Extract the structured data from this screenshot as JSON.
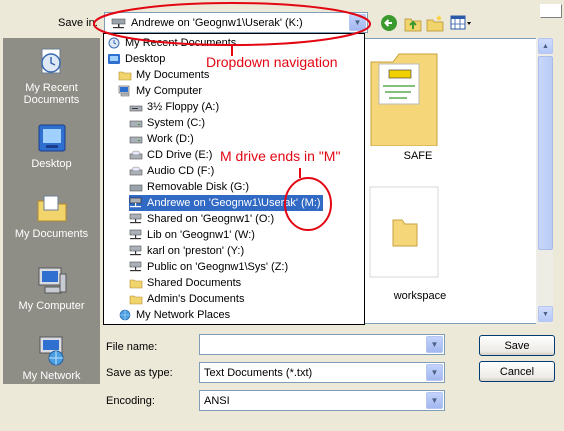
{
  "dialog": {
    "save_in_label": "Save in:",
    "save_in_value": "Andrewe on 'Geognw1\\Userak' (K:)"
  },
  "toolbar": {
    "icons": [
      "back-icon",
      "up-folder-icon",
      "new-folder-icon",
      "views-menu-icon"
    ]
  },
  "places": [
    {
      "label": "My Recent Documents",
      "icon": "recent-documents-icon"
    },
    {
      "label": "Desktop",
      "icon": "desktop-icon"
    },
    {
      "label": "My Documents",
      "icon": "my-documents-icon"
    },
    {
      "label": "My Computer",
      "icon": "my-computer-icon"
    },
    {
      "label": "My Network",
      "icon": "my-network-icon"
    }
  ],
  "dropdown": {
    "items": [
      {
        "label": "My Recent Documents",
        "icon": "recent-documents-icon"
      },
      {
        "label": "Desktop",
        "icon": "desktop-icon"
      },
      {
        "label": "My Documents",
        "icon": "folder-icon"
      },
      {
        "label": "My Computer",
        "icon": "computer-icon"
      },
      {
        "label": "3½ Floppy (A:)",
        "icon": "floppy-icon"
      },
      {
        "label": "System (C:)",
        "icon": "hard-drive-icon"
      },
      {
        "label": "Work (D:)",
        "icon": "hard-drive-icon"
      },
      {
        "label": "CD Drive (E:)",
        "icon": "cd-drive-icon"
      },
      {
        "label": "Audio CD (F:)",
        "icon": "cd-drive-icon"
      },
      {
        "label": "Removable Disk (G:)",
        "icon": "removable-disk-icon"
      },
      {
        "label": "Andrewe on 'Geognw1\\Userak' (M:)",
        "icon": "network-drive-icon",
        "selected": true
      },
      {
        "label": "Shared on 'Geognw1' (O:)",
        "icon": "network-drive-icon"
      },
      {
        "label": "Lib on 'Geognw1' (W:)",
        "icon": "network-drive-icon"
      },
      {
        "label": "karl on 'preston' (Y:)",
        "icon": "network-drive-icon"
      },
      {
        "label": "Public on 'Geognw1\\Sys' (Z:)",
        "icon": "network-drive-icon"
      },
      {
        "label": "Shared Documents",
        "icon": "folder-icon"
      },
      {
        "label": "Admin's Documents",
        "icon": "folder-icon"
      },
      {
        "label": "My Network Places",
        "icon": "network-places-icon"
      }
    ]
  },
  "files": [
    {
      "label": "SAFE",
      "icon": "folder-with-document-icon"
    },
    {
      "label": "workspace",
      "icon": "folder-icon"
    }
  ],
  "form": {
    "file_name_label": "File name:",
    "file_name_value": "",
    "save_as_type_label": "Save as type:",
    "save_as_type_value": "Text Documents (*.txt)",
    "encoding_label": "Encoding:",
    "encoding_value": "ANSI",
    "save_label": "Save",
    "cancel_label": "Cancel"
  },
  "annotations": {
    "dropdown_note": "Dropdown navigation",
    "m_drive_note": "M drive ends in \"M\""
  },
  "colors": {
    "selection": "#316ac5",
    "annotation": "#e30613",
    "places_bar": "#8f8e86"
  }
}
